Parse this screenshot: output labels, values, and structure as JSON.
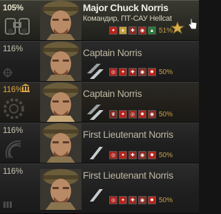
{
  "crew": [
    {
      "percent": "105%",
      "name": "Major Chuck Norris",
      "role": "Командир, ПТ-САУ Hellcat",
      "skill_percent": "51%",
      "rank_icon": "major-rank-insignia-icon",
      "slot_icon": "binoculars-slot-icon",
      "selected": true,
      "bonus": false,
      "skill_colors": [
        "#b8231a",
        "#c2a03a",
        "#8a2a22",
        "#a3241c",
        "#2a7a3a"
      ]
    },
    {
      "percent": "116%",
      "name": "Captain Norris",
      "skill_percent": "50%",
      "rank_icon": "captain-rank-insignia-icon",
      "slot_icon": "crosshair-slot-icon",
      "selected": false,
      "bonus": false,
      "skill_colors": [
        "#a8241b",
        "#b8231a",
        "#a3241c",
        "#8a2a22",
        "#b8231a"
      ]
    },
    {
      "percent": "116%",
      "name": "Captain Norris",
      "skill_percent": "50%",
      "rank_icon": "captain-rank-insignia-icon",
      "slot_icon": "gear-slot-icon",
      "selected": false,
      "bonus": true,
      "skill_colors": [
        "#7a2a1e",
        "#b8231a",
        "#a3241c",
        "#b8231a",
        "#8a2a22"
      ]
    },
    {
      "percent": "116%",
      "name": "First Lieutenant Norris",
      "skill_percent": "50%",
      "rank_icon": "first-lieutenant-rank-insignia-icon",
      "slot_icon": "radio-slot-icon",
      "selected": false,
      "bonus": false,
      "skill_colors": [
        "#a8241b",
        "#b8231a",
        "#a3241c",
        "#8a2a22",
        "#b8231a"
      ]
    },
    {
      "percent": "116%",
      "name": "First Lieutenant Norris",
      "skill_percent": "50%",
      "rank_icon": "first-lieutenant-rank-insignia-icon",
      "slot_icon": "ammo-slot-icon",
      "selected": false,
      "bonus": false,
      "skill_colors": [
        "#a8241b",
        "#b8231a",
        "#a3241c",
        "#8a2a22",
        "#b8231a"
      ]
    }
  ]
}
